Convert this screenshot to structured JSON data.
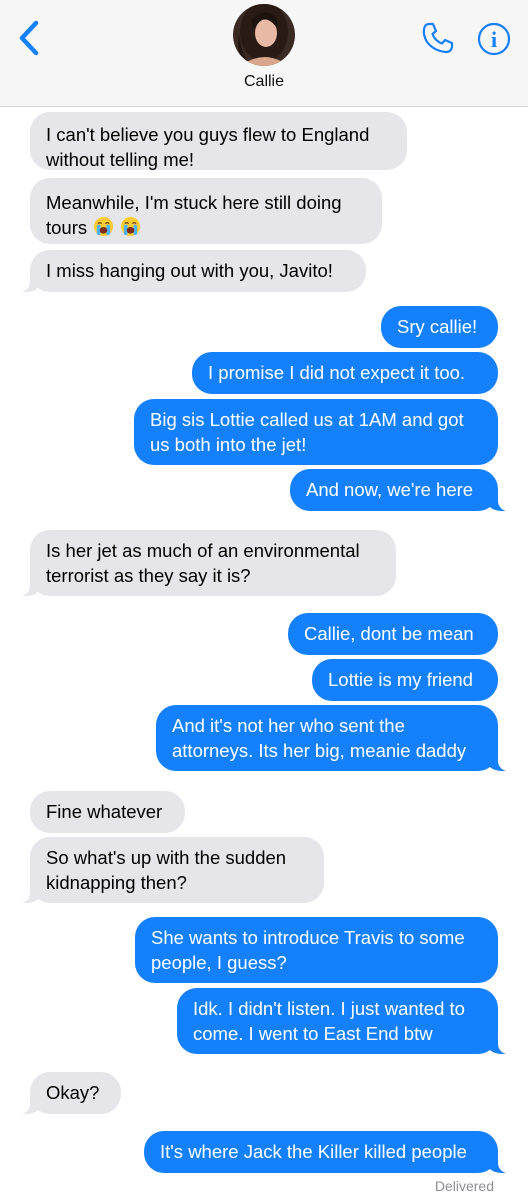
{
  "header": {
    "contact_name": "Callie",
    "back_icon": "chevron-left-icon",
    "call_icon": "phone-icon",
    "info_icon": "info-icon",
    "info_glyph": "i",
    "accent_color": "#1580fb"
  },
  "messages": [
    {
      "direction": "incoming",
      "line1": "I can't believe you guys flew to England",
      "line2": "without telling me!"
    },
    {
      "direction": "incoming",
      "line1": "Meanwhile, I'm stuck here still doing",
      "line2": "tours",
      "emoji": [
        "loudly-crying-face",
        "loudly-crying-face"
      ]
    },
    {
      "direction": "incoming",
      "line1": "I miss hanging out with you, Javito!"
    },
    {
      "direction": "outgoing",
      "line1": "Sry callie!"
    },
    {
      "direction": "outgoing",
      "line1": "I promise I did not expect it too."
    },
    {
      "direction": "outgoing",
      "line1": "Big sis Lottie called us at 1AM and got",
      "line2": "us both into the jet!"
    },
    {
      "direction": "outgoing",
      "line1": "And now, we're here"
    },
    {
      "direction": "incoming",
      "line1": "Is her jet as much of an environmental",
      "line2": "terrorist as they say it is?"
    },
    {
      "direction": "outgoing",
      "line1": "Callie, dont be mean"
    },
    {
      "direction": "outgoing",
      "line1": "Lottie is my friend"
    },
    {
      "direction": "outgoing",
      "line1": "And it's not her who sent the",
      "line2": "attorneys. Its her big, meanie daddy"
    },
    {
      "direction": "incoming",
      "line1": "Fine whatever"
    },
    {
      "direction": "incoming",
      "line1": "So what's up with the sudden",
      "line2": "kidnapping then?"
    },
    {
      "direction": "outgoing",
      "line1": "She wants to introduce Travis to some",
      "line2": "people, I guess?"
    },
    {
      "direction": "outgoing",
      "line1": "Idk. I didn't listen. I just wanted to",
      "line2": "come. I went to East End btw"
    },
    {
      "direction": "incoming",
      "line1": "Okay?"
    },
    {
      "direction": "outgoing",
      "line1": "It's where Jack the Killer killed people"
    }
  ],
  "status": {
    "delivered": "Delivered"
  },
  "colors": {
    "incoming_bubble": "#e5e5ea",
    "outgoing_bubble": "#1580fb",
    "header_bg": "#f7f7f7"
  }
}
